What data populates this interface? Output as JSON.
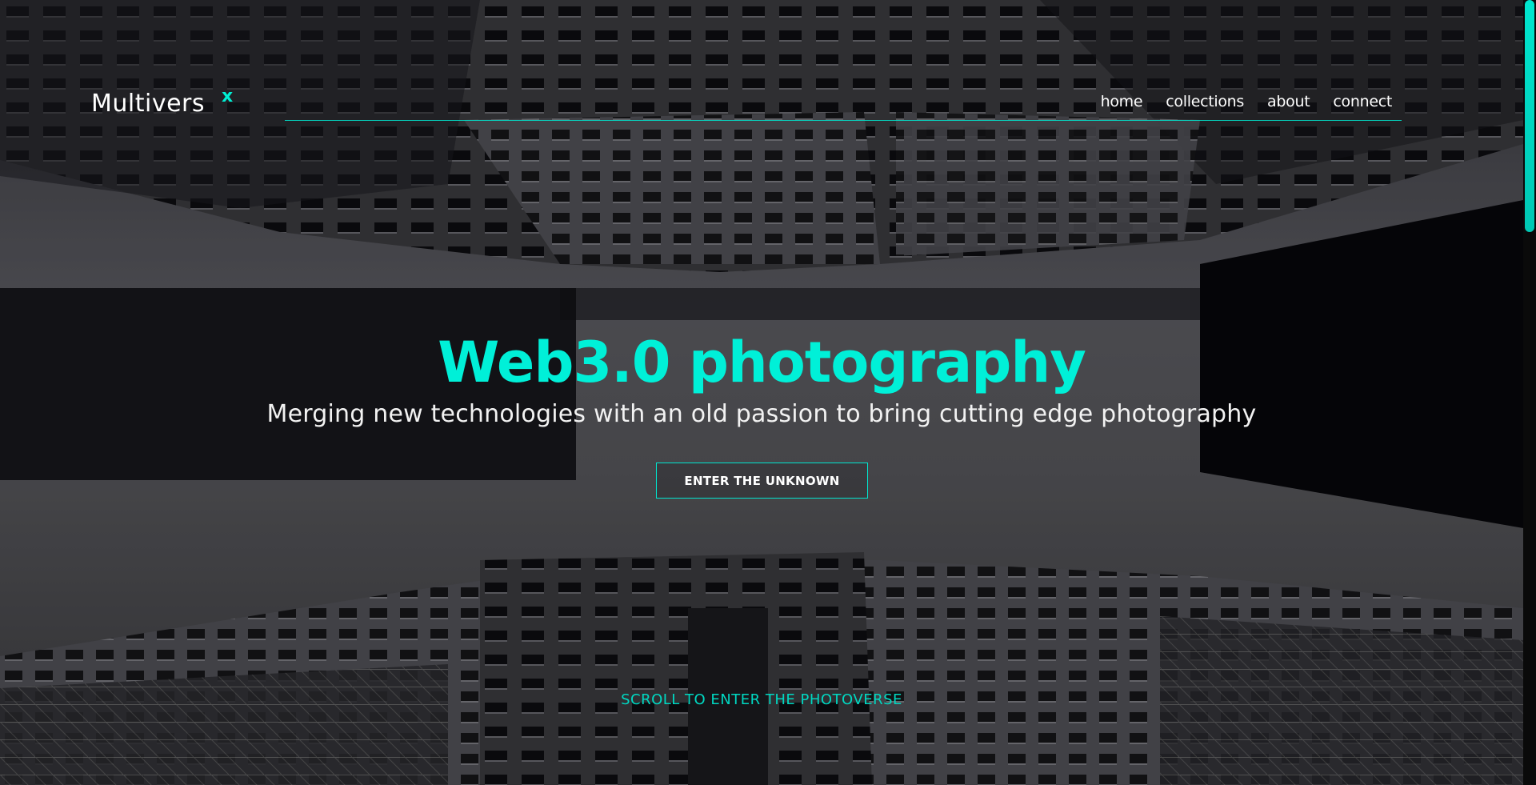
{
  "brand": {
    "name": "Multivers",
    "mark": "x",
    "accent_color": "#00f0d4"
  },
  "nav": {
    "items": [
      {
        "label": "home"
      },
      {
        "label": "collections"
      },
      {
        "label": "about"
      },
      {
        "label": "connect"
      }
    ]
  },
  "hero": {
    "title": "Web3.0 photography",
    "subtitle": "Merging new technologies with an old passion to bring cutting edge photography",
    "cta_label": "ENTER THE UNKNOWN",
    "scroll_hint": "SCROLL TO ENTER THE PHOTOVERSE",
    "background": "grayscale upward view of tall buildings against sky"
  }
}
